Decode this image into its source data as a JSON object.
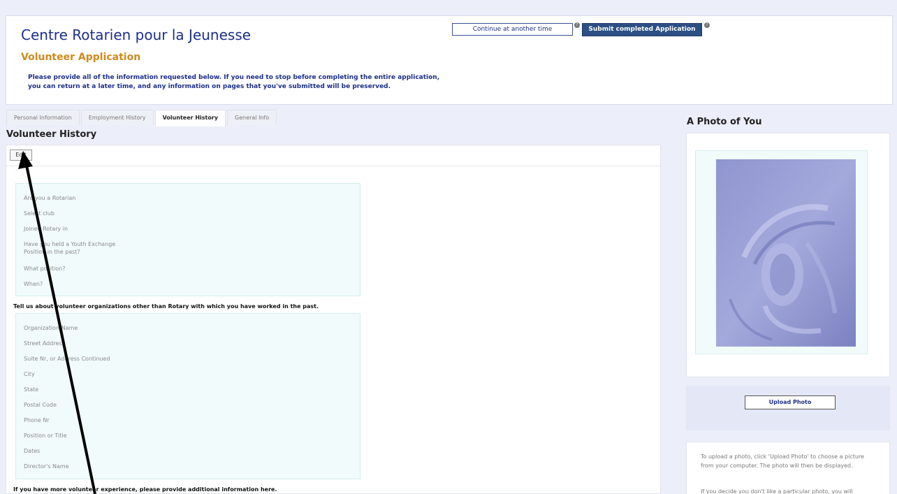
{
  "header": {
    "org_title": "Centre Rotarien pour la Jeunesse",
    "app_title": "Volunteer Application",
    "instructions": "Please provide all of the information requested below. If you need to stop before completing the entire application, you can return at a later time, and any information on pages that you've submitted will be preserved.",
    "continue_label": "Continue at another time",
    "submit_label": "Submit completed Application",
    "help_glyph": "?"
  },
  "tabs": [
    {
      "label": "Personal Information",
      "active": false
    },
    {
      "label": "Employment History",
      "active": false
    },
    {
      "label": "Volunteer History",
      "active": true
    },
    {
      "label": "General Info",
      "active": false
    }
  ],
  "section": {
    "title": "Volunteer History",
    "edit_label": "Edit"
  },
  "rotary_fields": [
    "Are you a Rotarian",
    "Select club",
    "Joined Rotary in",
    "Have you held a Youth Exchange Position in the past?",
    "What position?",
    "When?"
  ],
  "orgs_intro": "Tell us about volunteer organizations other than Rotary with which you have worked in the past.",
  "org_fields": [
    "Organization Name",
    "Street Address",
    "Suite Nr, or Address Continued",
    "City",
    "State",
    "Postal Code",
    "Phone Nr",
    "Position or Title",
    "Dates",
    "Director's Name"
  ],
  "more_experience": "If you have more volunteer experience, please provide additional information here.",
  "photo": {
    "heading": "A Photo of You",
    "upload_label": "Upload Photo",
    "help_1": "To upload a photo, click 'Upload Photo' to choose a picture from your computer. The photo will then be displayed.",
    "help_2": "If you decide you don't like a particular photo, you will"
  },
  "colors": {
    "title_blue": "#1c2f8a",
    "accent_orange": "#d08a1e",
    "submit_bg": "#2c4f84",
    "field_bg": "#f1fbfb",
    "page_bg": "#eceef9"
  }
}
